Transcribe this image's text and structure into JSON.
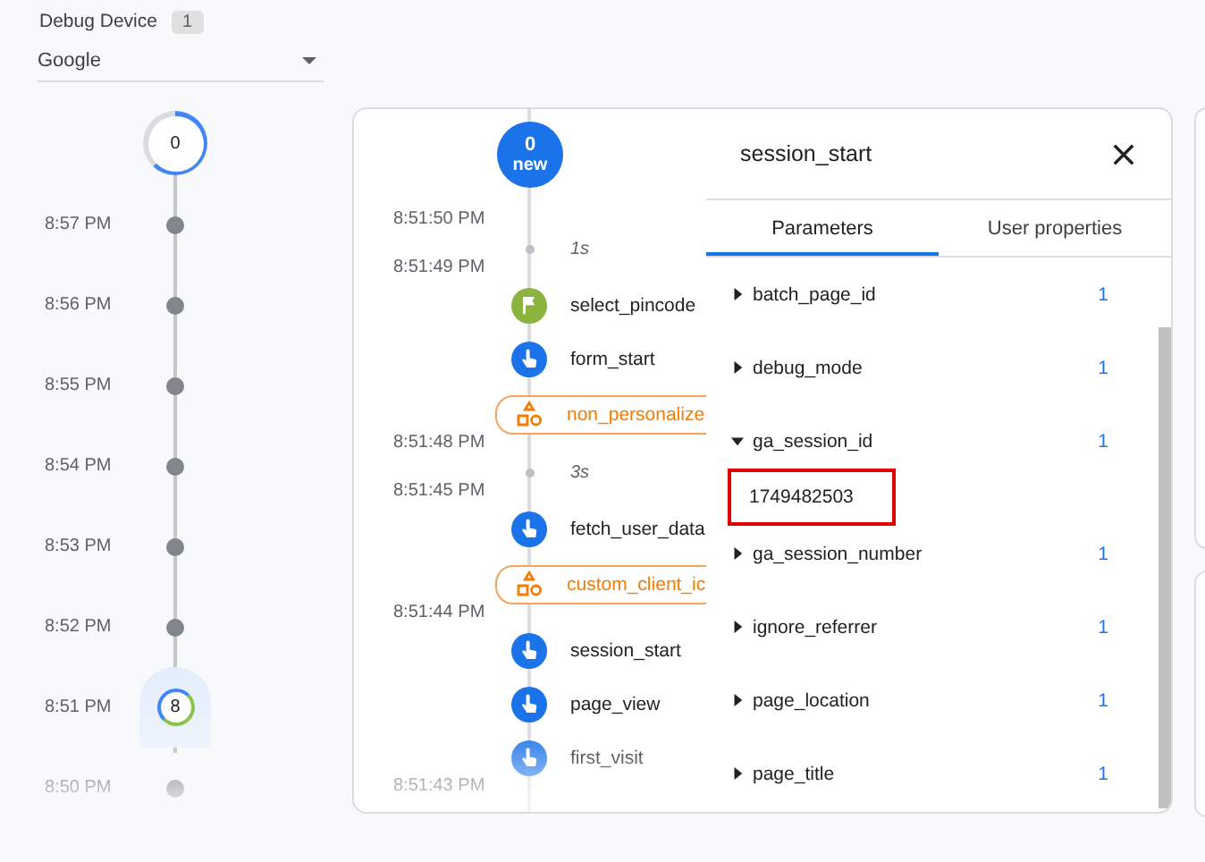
{
  "debug_device": {
    "label": "Debug Device",
    "count": "1",
    "selected_device": "Google"
  },
  "minutes": {
    "live_count": "0",
    "rows": [
      {
        "time": "8:57 PM",
        "selected": false
      },
      {
        "time": "8:56 PM",
        "selected": false
      },
      {
        "time": "8:55 PM",
        "selected": false
      },
      {
        "time": "8:54 PM",
        "selected": false
      },
      {
        "time": "8:53 PM",
        "selected": false
      },
      {
        "time": "8:52 PM",
        "selected": false
      },
      {
        "time": "8:51 PM",
        "count": "8",
        "selected": true
      },
      {
        "time": "8:50 PM",
        "selected": false
      }
    ]
  },
  "seconds": {
    "new_count": "0",
    "new_label": "new",
    "items": [
      {
        "kind": "time",
        "text": "8:51:50 PM"
      },
      {
        "kind": "gap",
        "text": "1s"
      },
      {
        "kind": "time",
        "text": "8:51:49 PM"
      },
      {
        "kind": "flag",
        "text": "select_pincode"
      },
      {
        "kind": "click",
        "text": "form_start"
      },
      {
        "kind": "alert",
        "text": "non_personalize"
      },
      {
        "kind": "time",
        "text": "8:51:48 PM"
      },
      {
        "kind": "gap",
        "text": "3s"
      },
      {
        "kind": "time",
        "text": "8:51:45 PM"
      },
      {
        "kind": "click",
        "text": "fetch_user_data"
      },
      {
        "kind": "alert",
        "text": "custom_client_ic"
      },
      {
        "kind": "time",
        "text": "8:51:44 PM"
      },
      {
        "kind": "click",
        "text": "session_start"
      },
      {
        "kind": "click",
        "text": "page_view"
      },
      {
        "kind": "click",
        "text": "first_visit"
      },
      {
        "kind": "time",
        "text": "8:51:43 PM"
      }
    ]
  },
  "detail": {
    "title": "session_start",
    "tabs": [
      {
        "label": "Parameters",
        "selected": true
      },
      {
        "label": "User properties",
        "selected": false
      }
    ],
    "params": [
      {
        "name": "batch_page_id",
        "count": "1",
        "expanded": false
      },
      {
        "name": "debug_mode",
        "count": "1",
        "expanded": false
      },
      {
        "name": "ga_session_id",
        "count": "1",
        "expanded": true,
        "value": "1749482503",
        "highlighted": true
      },
      {
        "name": "ga_session_number",
        "count": "1",
        "expanded": false
      },
      {
        "name": "ignore_referrer",
        "count": "1",
        "expanded": false
      },
      {
        "name": "page_location",
        "count": "1",
        "expanded": false
      },
      {
        "name": "page_title",
        "count": "1",
        "expanded": false
      }
    ]
  }
}
